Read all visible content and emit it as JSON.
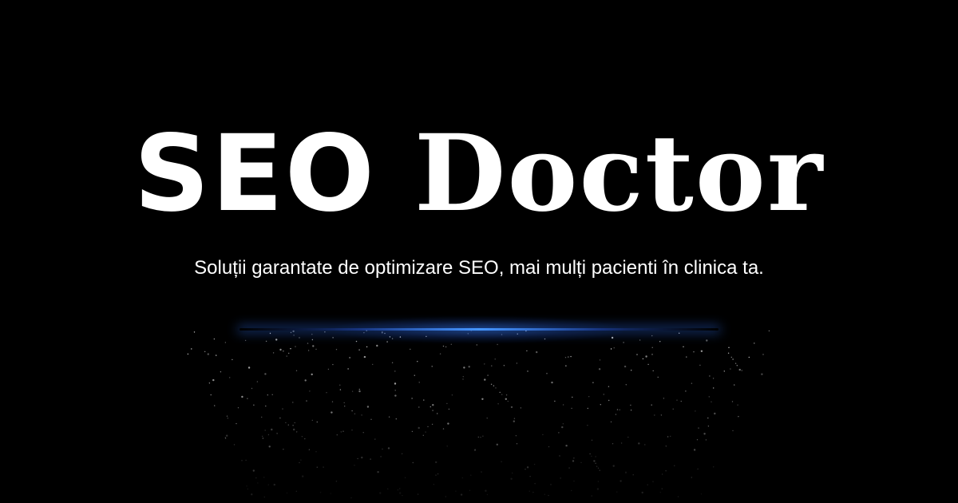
{
  "hero": {
    "title_part1": "SEO ",
    "title_part2": "Doctor",
    "tagline": "Soluții garantate de optimizare SEO, mai mulți pacienti în clinica ta."
  },
  "colors": {
    "background": "#000000",
    "text": "#ffffff",
    "accent_glow": "#4696ff"
  }
}
